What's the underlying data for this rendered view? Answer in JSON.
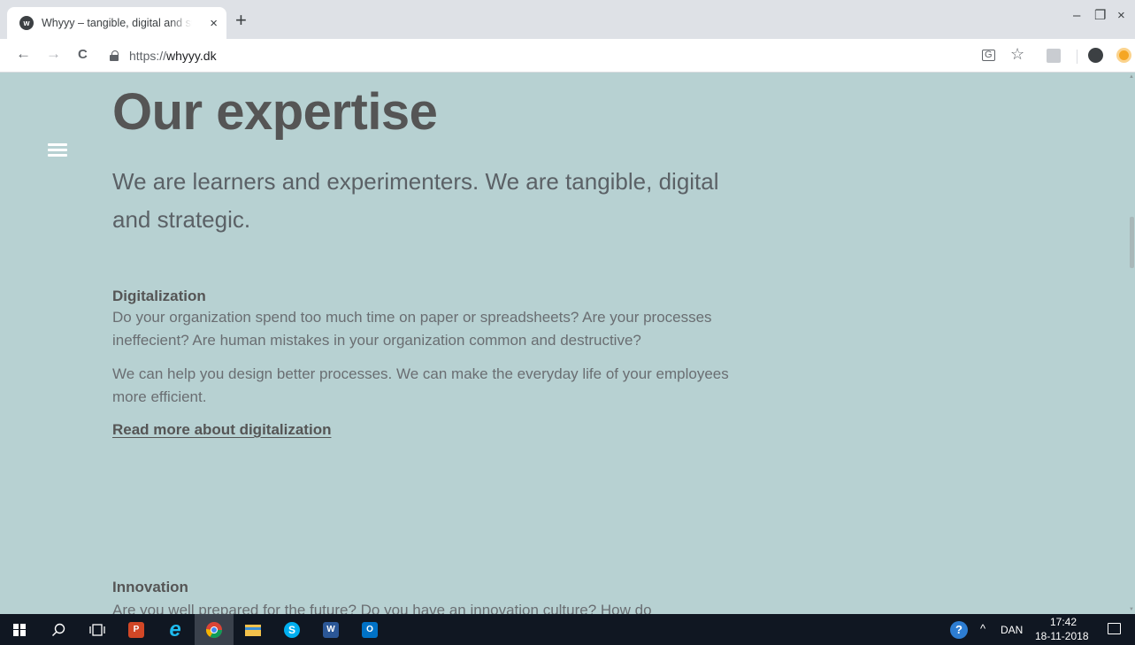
{
  "browser": {
    "tab": {
      "favicon_letter": "w",
      "title": "Whyyy – tangible, digital and strategic",
      "close_glyph": "×"
    },
    "new_tab_glyph": "+",
    "window_controls": {
      "minimize": "–",
      "restore": "❐",
      "close": "×"
    },
    "nav": {
      "back": "←",
      "forward": "→",
      "reload": "C"
    },
    "address": {
      "scheme": "https://",
      "host": "whyyy.dk"
    },
    "toolbar_icons": [
      "translate-icon",
      "star-icon",
      "pdf-extension-icon",
      "account-icon",
      "extension-icon"
    ]
  },
  "page": {
    "heading": "Our expertise",
    "lead": "We are learners and experimenters. We are tangible, digital and strategic.",
    "sections": [
      {
        "title": "Digitalization",
        "paragraphs": [
          "Do your organization spend too much time on paper or spreadsheets? Are your processes ineffecient? Are human mistakes in your organization common and destructive?",
          "We can help you design better processes. We can make the everyday life of your employees more efficient."
        ],
        "link": "Read more about digitalization"
      },
      {
        "title": "Innovation",
        "paragraphs": [
          "Are you well prepared for the future? Do you have an innovation culture? How do"
        ]
      }
    ]
  },
  "taskbar": {
    "apps": [
      "windows-start-icon",
      "search-icon",
      "task-view-icon",
      "powerpoint-icon",
      "internet-explorer-icon",
      "chrome-icon",
      "file-explorer-icon",
      "skype-icon",
      "word-icon",
      "outlook-icon"
    ],
    "tray": {
      "language": "DAN",
      "time": "17:42",
      "date": "18-11-2018"
    }
  }
}
